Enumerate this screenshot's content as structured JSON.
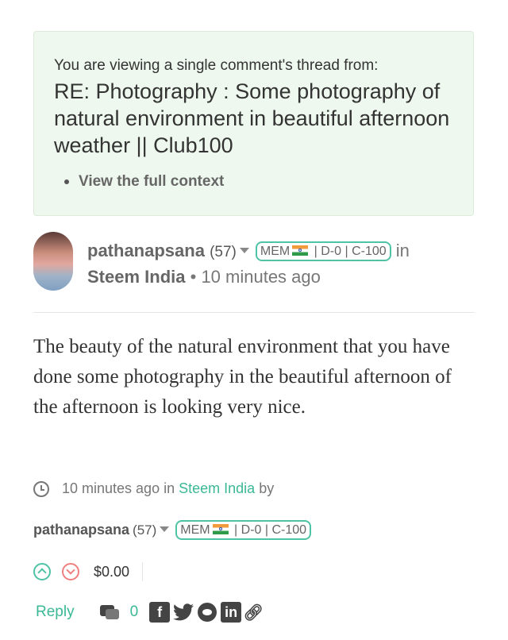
{
  "notice": {
    "lead": "You are viewing a single comment's thread from:",
    "title": "RE: Photography : Some photography of natural environment in beautiful afternoon weather || Club100",
    "context_link": "View the full context"
  },
  "comment": {
    "author": "pathanapsana",
    "reputation": "(57)",
    "badge": {
      "prefix": "MEM",
      "suffix": " | D-0 | C-100"
    },
    "in_word": "in",
    "community": "Steem India",
    "separator": "•",
    "time_ago": "10 minutes ago",
    "body": "The beauty of the natural environment that you have done some photography in the beautiful afternoon of the afternoon is looking very nice."
  },
  "footer": {
    "time_ago": "10 minutes ago",
    "in_word": "in",
    "community": "Steem India",
    "by_word": "by",
    "author": "pathanapsana",
    "reputation": "(57)",
    "badge": {
      "prefix": "MEM",
      "suffix": " | D-0 | C-100"
    },
    "payout": "$0.00",
    "reply_label": "Reply",
    "comment_count": "0"
  },
  "icons": {
    "avatar": "avatar-photo",
    "caret": "chevron-down-icon",
    "flag": "india-flag-icon",
    "clock": "clock-icon",
    "upvote": "upvote-icon",
    "downvote": "downvote-icon",
    "comments": "comments-icon",
    "share": [
      "facebook-icon",
      "twitter-icon",
      "reddit-icon",
      "linkedin-icon",
      "link-icon"
    ]
  },
  "colors": {
    "accent": "#3bb895",
    "badge_border": "#4fc3a5",
    "downvote": "#f08080",
    "notice_bg": "#eef8ee"
  }
}
